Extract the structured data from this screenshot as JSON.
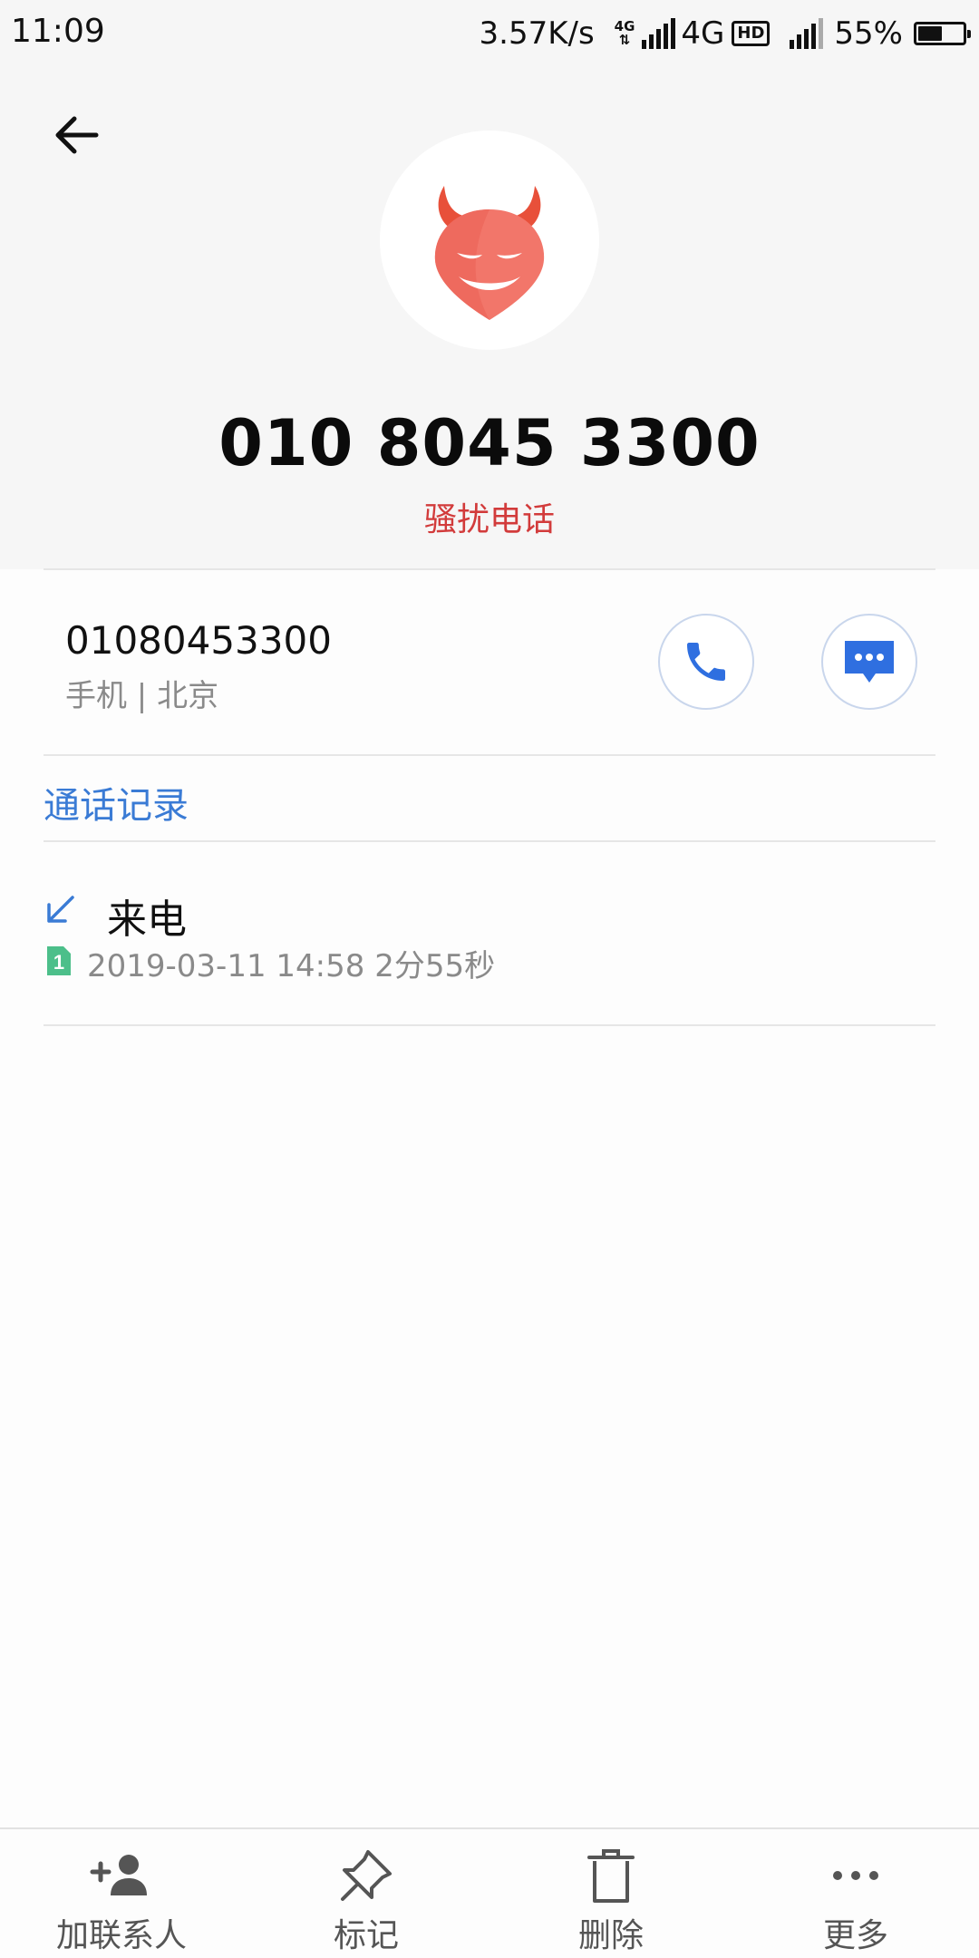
{
  "status_bar": {
    "time": "11:09",
    "net_speed": "3.57K/s",
    "tiny_network": "4G",
    "network": "4G",
    "hd": "HD",
    "battery_percent": "55%",
    "battery_level": 0.55
  },
  "header": {
    "avatar_icon": "devil-face-icon",
    "phone_title": "010 8045 3300",
    "spam_label": "骚扰电话",
    "spam_color": "#d23b3b"
  },
  "number": {
    "value": "01080453300",
    "sub": "手机 | 北京"
  },
  "history": {
    "title": "通话记录",
    "title_color": "#3a7bd5",
    "records": [
      {
        "type": "来电",
        "sim": "1",
        "datetime": "2019-03-11 14:58",
        "duration": "2分55秒",
        "detail": "2019-03-11 14:58  2分55秒"
      }
    ]
  },
  "bottom_bar": {
    "add_contact": "加联系人",
    "mark": "标记",
    "delete": "删除",
    "more": "更多"
  }
}
